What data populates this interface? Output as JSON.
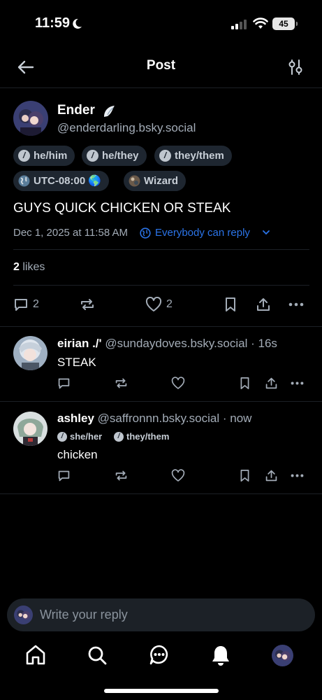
{
  "status_bar": {
    "time": "11:59",
    "battery": "45"
  },
  "header": {
    "title": "Post"
  },
  "post": {
    "author_name": "Ender",
    "author_handle": "@enderdarling.bsky.social",
    "tags": [
      "he/him",
      "he/they",
      "they/them",
      "UTC-08:00 🌎",
      "Wizard"
    ],
    "text": "GUYS QUICK CHICKEN OR STEAK",
    "date": "Dec 1, 2025 at 11:58 AM",
    "reply_setting": "Everybody can reply",
    "likes_count": "2",
    "likes_label": "likes",
    "reply_count": "2",
    "like_count": "2"
  },
  "replies": [
    {
      "name": "eirian ./'",
      "handle": "@sundaydoves.bsky.social",
      "time": "16s",
      "text": "STEAK"
    },
    {
      "name": "ashley",
      "handle": "@saffronnn.bsky.social",
      "time": "now",
      "tags": [
        "she/her",
        "they/them"
      ],
      "text": "chicken"
    }
  ],
  "composer": {
    "placeholder": "Write your reply"
  },
  "colors": {
    "accent": "#2b74e8",
    "tag_bg": "#1e2630",
    "muted": "#a3acb7"
  },
  "nav": [
    "home-icon",
    "search-icon",
    "chat-icon",
    "bell-icon",
    "avatar"
  ]
}
